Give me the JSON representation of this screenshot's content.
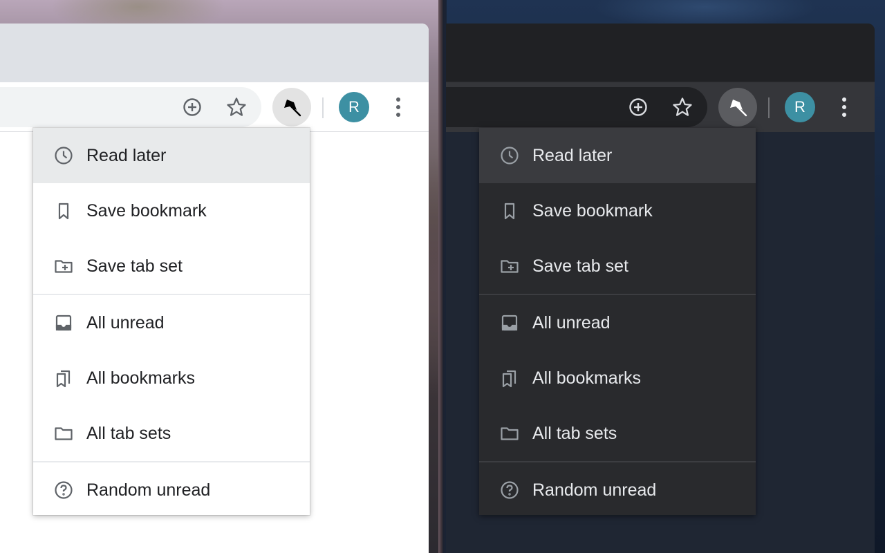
{
  "colors": {
    "avatar_bg": "#3d90a3",
    "light_window_bg": "#ffffff",
    "dark_window_bg": "#1f2633",
    "light_menu_bg": "#ffffff",
    "dark_menu_bg": "#292a2d"
  },
  "toolbar": {
    "avatar_initial": "R",
    "icons": [
      "add-circle-icon",
      "star-icon",
      "pushpin-icon",
      "more-vert-icon"
    ]
  },
  "menu": {
    "items": [
      {
        "label": "Read later",
        "icon": "clock-icon",
        "highlighted": true
      },
      {
        "label": "Save bookmark",
        "icon": "bookmark-icon"
      },
      {
        "label": "Save tab set",
        "icon": "folder-plus-icon"
      },
      {
        "label": "All unread",
        "icon": "inbox-icon"
      },
      {
        "label": "All bookmarks",
        "icon": "bookmarks-icon"
      },
      {
        "label": "All tab sets",
        "icon": "folder-icon"
      },
      {
        "label": "Random unread",
        "icon": "help-circle-icon"
      }
    ]
  }
}
